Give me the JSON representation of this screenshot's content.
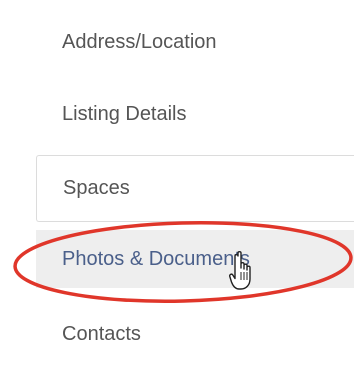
{
  "sidebar": {
    "items": [
      {
        "label": "Address/Location"
      },
      {
        "label": "Listing Details"
      },
      {
        "label": "Spaces"
      },
      {
        "label": "Photos & Documents"
      },
      {
        "label": "Contacts"
      }
    ]
  },
  "annotation": {
    "highlight_color": "#e0362a"
  },
  "colors": {
    "text": "#555555",
    "active_text": "#4a5f8a",
    "active_background": "#eeeeee",
    "border": "#dcdcdc"
  }
}
